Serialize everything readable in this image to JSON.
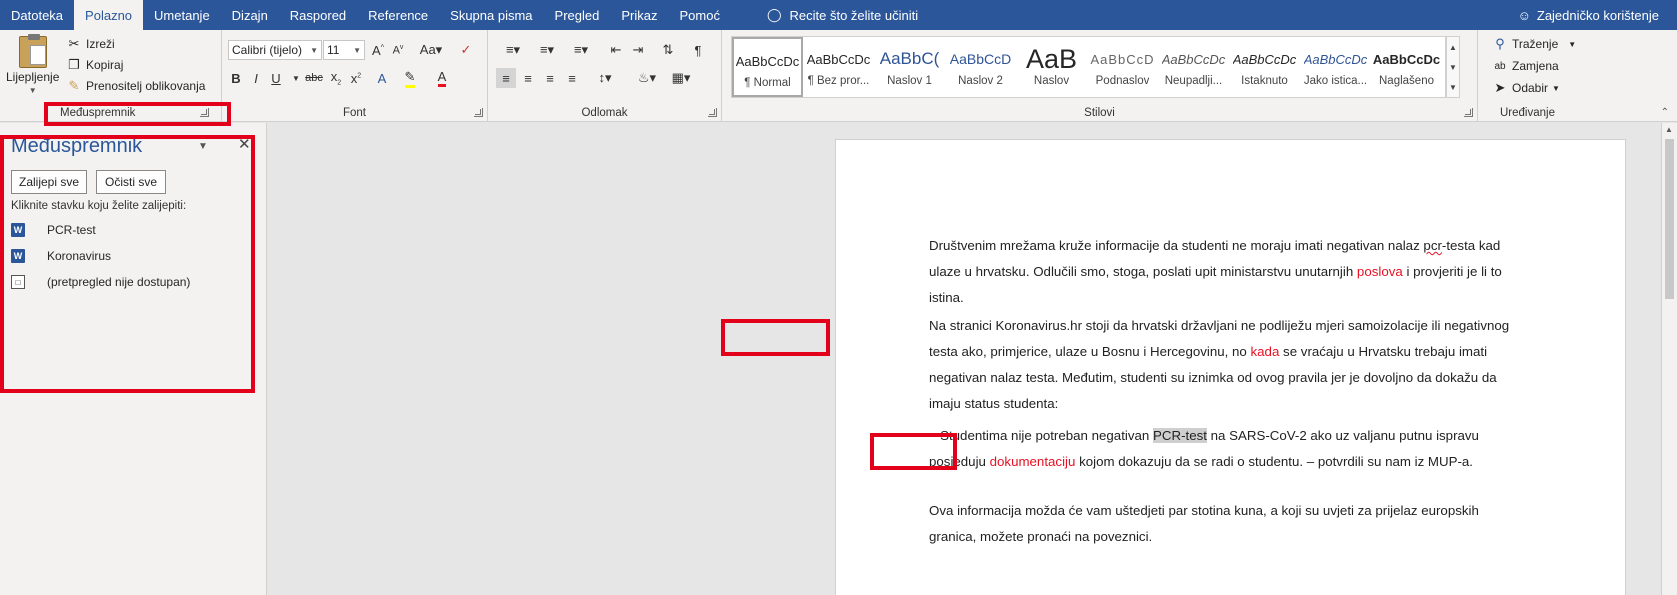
{
  "menubar": {
    "tabs": [
      "Datoteka",
      "Polazno",
      "Umetanje",
      "Dizajn",
      "Raspored",
      "Reference",
      "Skupna pisma",
      "Pregled",
      "Prikaz",
      "Pomoć"
    ],
    "tell_me": "Recite što želite učiniti",
    "share": "Zajedničko korištenje"
  },
  "ribbon": {
    "clipboard": {
      "paste": "Lijepljenje",
      "cut": "Izreži",
      "copy": "Kopiraj",
      "format_painter": "Prenositelj oblikovanja",
      "label": "Međuspremnik"
    },
    "font": {
      "family": "Calibri (tijelo)",
      "size": "11",
      "label": "Font"
    },
    "paragraph": {
      "label": "Odlomak"
    },
    "styles": {
      "label": "Stilovi",
      "items": [
        {
          "sample": "AaBbCcDc",
          "name": "¶ Normal"
        },
        {
          "sample": "AaBbCcDc",
          "name": "¶ Bez pror..."
        },
        {
          "sample": "AaBbC(",
          "name": "Naslov 1"
        },
        {
          "sample": "AaBbCcD",
          "name": "Naslov 2"
        },
        {
          "sample": "AaB",
          "name": "Naslov"
        },
        {
          "sample": "AaBbCcD",
          "name": "Podnaslov"
        },
        {
          "sample": "AaBbCcDc",
          "name": "Neupadlji..."
        },
        {
          "sample": "AaBbCcDc",
          "name": "Istaknuto"
        },
        {
          "sample": "AaBbCcDc",
          "name": "Jako istica..."
        },
        {
          "sample": "AaBbCcDc",
          "name": "Naglašeno"
        }
      ]
    },
    "editing": {
      "find": "Traženje",
      "replace": "Zamjena",
      "select": "Odabir",
      "label": "Uređivanje"
    }
  },
  "pane": {
    "title": "Međuspremnik",
    "paste_all": "Zalijepi sve",
    "clear_all": "Očisti sve",
    "hint": "Kliknite stavku koju želite zalijepiti:",
    "items": [
      "PCR-test",
      "Koronavirus",
      "(pretpregled nije dostupan)"
    ]
  },
  "document": {
    "p1": {
      "a": "Društvenim mrežama kruže informacije da studenti ne moraju imati negativan nalaz ",
      "b": "pcr",
      "c": "-testa kad ulaze u hrvatsku. Odlučili smo, stoga, poslati upit ministarstvu unutarnjih ",
      "d": "poslova",
      "e": " i provjeriti je li to istina."
    },
    "p2": {
      "a": "Na ",
      "b": "stranici",
      "c": " Koronavirus.hr stoji da hrvatski državljani ne podliježu mjeri samoizolacije ili negativnog testa ako, primjerice, ulaze u Bosnu i Hercegovinu, no ",
      "d": "kada",
      "e": " se vraćaju u Hrvatsku trebaju imati negativan nalaz testa. Međutim, studenti su iznimka od ovog pravila jer je dovoljno da dokažu da imaju status studenta:"
    },
    "p3": {
      "a": "– Studentima nije potreban negativan ",
      "b": "PCR-test",
      "c": " na SARS-CoV-2 ako uz valjanu putnu ispravu posjeduju ",
      "d": "dokumentaciju",
      "e": " kojom dokazuju da se radi o studentu. – potvrdili su nam iz MUP-a."
    },
    "p4": "Ova informacija možda će vam uštedjeti par stotina kuna, a koji su uvjeti za prijelaz europskih granica, možete pronaći na poveznici."
  },
  "colors": {
    "accent": "#2b579a",
    "annotation": "#e2001a",
    "red_text": "#e81123"
  }
}
